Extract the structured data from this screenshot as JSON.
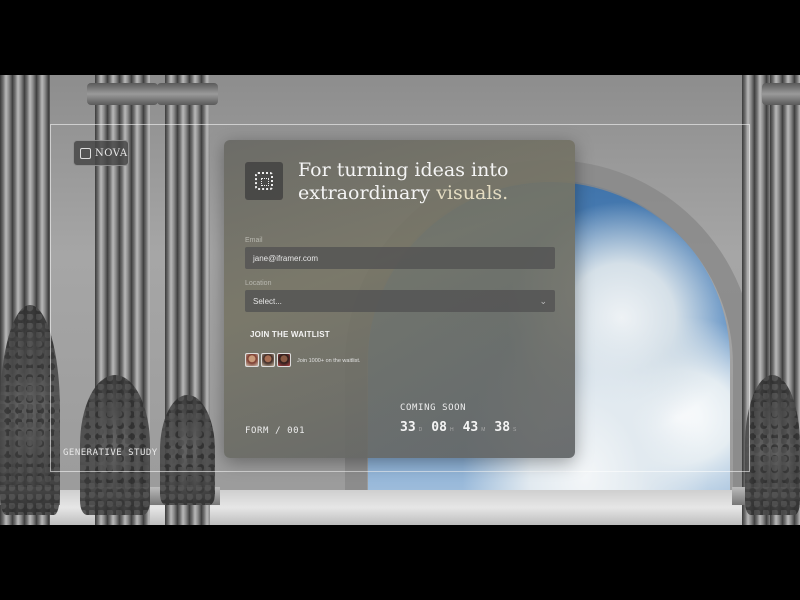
{
  "brand": {
    "name": "NOVA"
  },
  "footer_tag": "GENERATIVE STUDY",
  "card": {
    "headline_part1": "For turning ideas into",
    "headline_part2": "extraordinary",
    "headline_accent": "visuals.",
    "email": {
      "label": "Email",
      "value": "jane@iframer.com"
    },
    "location": {
      "label": "Location",
      "value": "Select..."
    },
    "join_button": "JOIN THE WAITLIST",
    "waitlist_note": "Join 1000+ on the waitlist.",
    "form_code": "FORM / 001",
    "coming_soon": "COMING SOON",
    "countdown": [
      {
        "value": "33",
        "unit": "D"
      },
      {
        "value": "08",
        "unit": "H"
      },
      {
        "value": "43",
        "unit": "M"
      },
      {
        "value": "38",
        "unit": "S"
      }
    ]
  },
  "colors": {
    "accent_text": "#e4dcc2",
    "card_bg": "#6a6a64"
  },
  "icons": {
    "brand_logo": "nova-logo-icon",
    "card_logo": "app-logo-icon",
    "select_chevron": "chevron-down-icon"
  }
}
